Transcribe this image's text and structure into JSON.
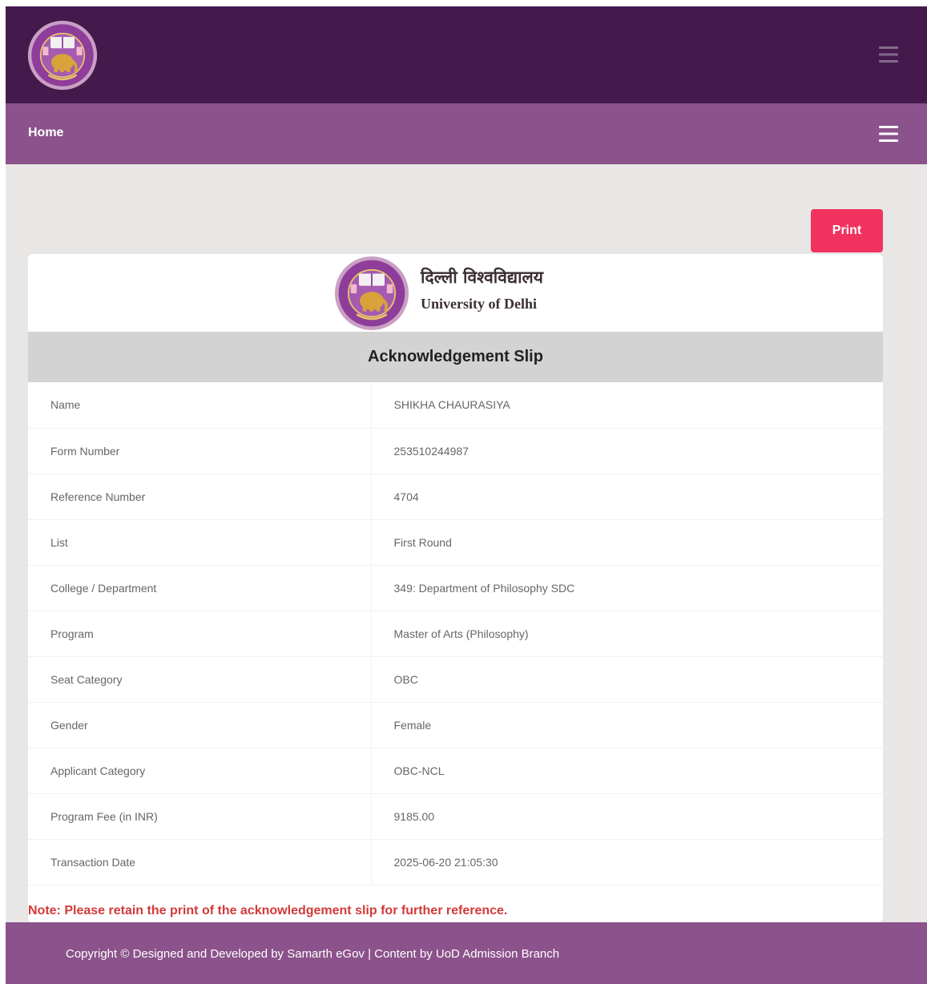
{
  "colors": {
    "topbar": "#441a4d",
    "navbar": "#8b528b",
    "print_button": "#f2335f",
    "note_text": "#d23a3a",
    "title_band": "#d3d3d3"
  },
  "header": {
    "logo_icon": "university-seal-icon",
    "menu_icon": "hamburger-menu-icon"
  },
  "nav": {
    "home_label": "Home",
    "menu_icon": "hamburger-menu-icon"
  },
  "actions": {
    "print_label": "Print"
  },
  "slip": {
    "university_name_hindi": "दिल्ली विश्वविद्यालय",
    "university_name_english": "University of Delhi",
    "title": "Acknowledgement Slip",
    "rows": [
      {
        "label": "Name",
        "value": "SHIKHA CHAURASIYA"
      },
      {
        "label": "Form Number",
        "value": "253510244987"
      },
      {
        "label": "Reference Number",
        "value": "4704"
      },
      {
        "label": "List",
        "value": "First Round"
      },
      {
        "label": "College / Department",
        "value": "349: Department of Philosophy SDC"
      },
      {
        "label": "Program",
        "value": "Master of Arts (Philosophy)"
      },
      {
        "label": "Seat Category",
        "value": "OBC"
      },
      {
        "label": "Gender",
        "value": "Female"
      },
      {
        "label": "Applicant Category",
        "value": "OBC-NCL"
      },
      {
        "label": "Program Fee (in INR)",
        "value": "9185.00"
      },
      {
        "label": "Transaction Date",
        "value": "2025-06-20 21:05:30"
      }
    ],
    "note": "Note: Please retain the print of the acknowledgement slip for further reference."
  },
  "footer": {
    "text": "Copyright © Designed and Developed by Samarth eGov | Content by UoD Admission Branch"
  }
}
